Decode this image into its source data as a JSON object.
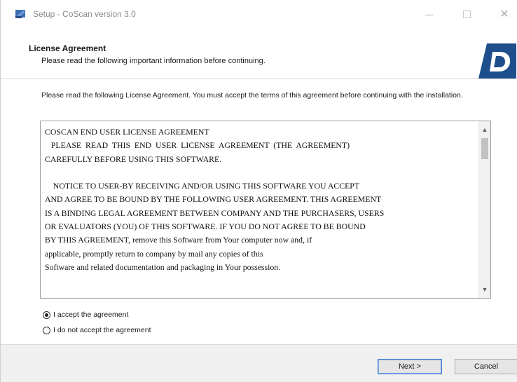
{
  "window": {
    "title": "Setup - CoScan version 3.0"
  },
  "header": {
    "title": "License Agreement",
    "subtitle": "Please read the following important information before continuing."
  },
  "intro": {
    "text": "Please read the following License Agreement. You must accept the terms of this agreement before continuing with the installation."
  },
  "license": {
    "text": "COSCAN END USER LICENSE AGREEMENT\n   PLEASE  READ  THIS  END  USER  LICENSE  AGREEMENT  (THE  AGREEMENT)\nCAREFULLY BEFORE USING THIS SOFTWARE.\n\n    NOTICE TO USER-BY RECEIVING AND/OR USING THIS SOFTWARE YOU ACCEPT\nAND AGREE TO BE BOUND BY THE FOLLOWING USER AGREEMENT. THIS AGREEMENT\nIS A BINDING LEGAL AGREEMENT BETWEEN COMPANY AND THE PURCHASERS, USERS\nOR EVALUATORS (YOU) OF THIS SOFTWARE. IF YOU DO NOT AGREE TO BE BOUND\nBY THIS AGREEMENT, remove this Software from Your computer now and, if\napplicable, promptly return to company by mail any copies of this\nSoftware and related documentation and packaging in Your possession."
  },
  "radios": {
    "accept_label": "I accept the agreement",
    "decline_label": "I do not accept the agreement",
    "selected": "accept"
  },
  "buttons": {
    "next_label": "Next >",
    "cancel_label": "Cancel"
  },
  "colors": {
    "logo_blue": "#1f4e8c",
    "accent_border": "#4a7fd1"
  }
}
